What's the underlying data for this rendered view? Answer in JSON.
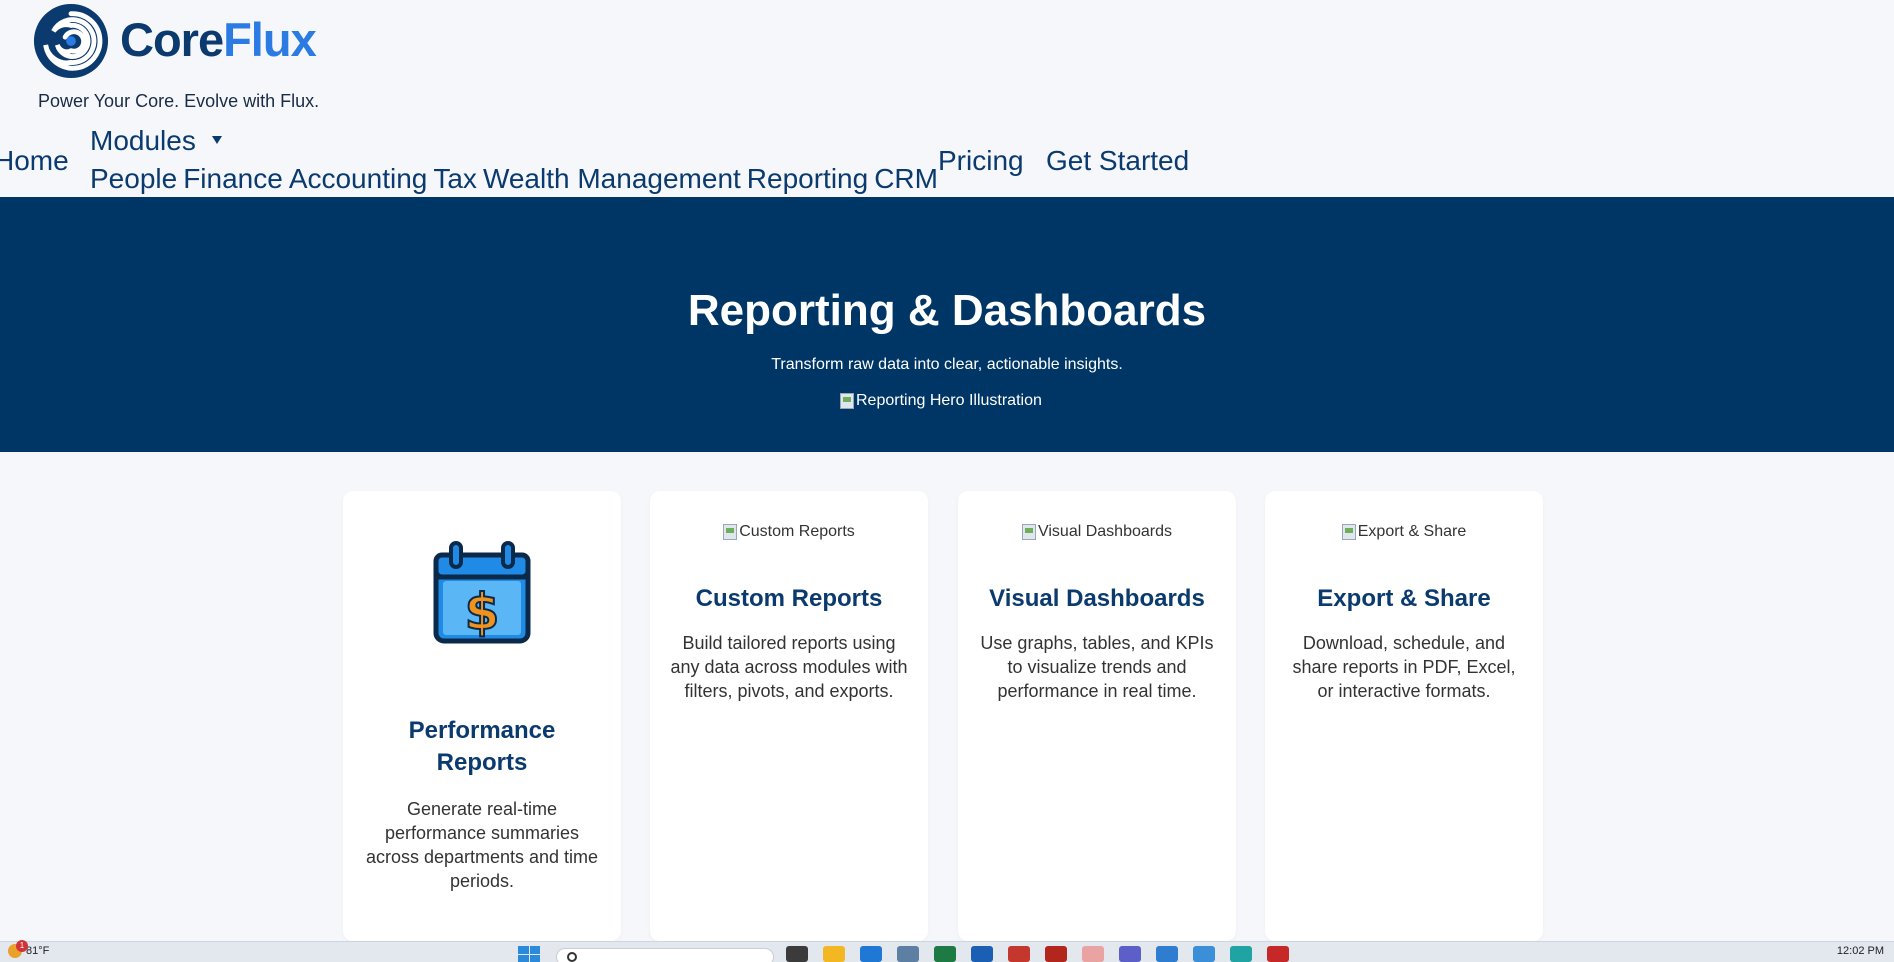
{
  "brand": {
    "name_part1": "Core",
    "name_part2": "Flux",
    "tagline": "Power Your Core. Evolve with Flux.",
    "colors": {
      "primary": "#0b3a6e",
      "accent": "#2b7be3",
      "hero_bg": "#003665"
    }
  },
  "nav": {
    "home": "Home",
    "modules": "Modules",
    "submenu": [
      "People",
      "Finance",
      "Accounting",
      "Tax",
      "Wealth Management",
      "Reporting",
      "CRM"
    ],
    "pricing": "Pricing",
    "get_started": "Get Started"
  },
  "hero": {
    "title": "Reporting & Dashboards",
    "subtitle": "Transform raw data into clear, actionable insights.",
    "image_alt": "Reporting Hero Illustration"
  },
  "cards": [
    {
      "icon": "calendar-dollar-icon",
      "title": "Performance Reports",
      "description": "Generate real-time performance summaries across departments and time periods."
    },
    {
      "image_alt": "Custom Reports",
      "title": "Custom Reports",
      "description": "Build tailored reports using any data across modules with filters, pivots, and exports."
    },
    {
      "image_alt": "Visual Dashboards",
      "title": "Visual Dashboards",
      "description": "Use graphs, tables, and KPIs to visualize trends and performance in real time."
    },
    {
      "image_alt": "Export & Share",
      "title": "Export & Share",
      "description": "Download, schedule, and share reports in PDF, Excel, or interactive formats."
    }
  ],
  "taskbar": {
    "weather": "81°F",
    "weather_badge": "1",
    "clock": "12:02 PM"
  }
}
